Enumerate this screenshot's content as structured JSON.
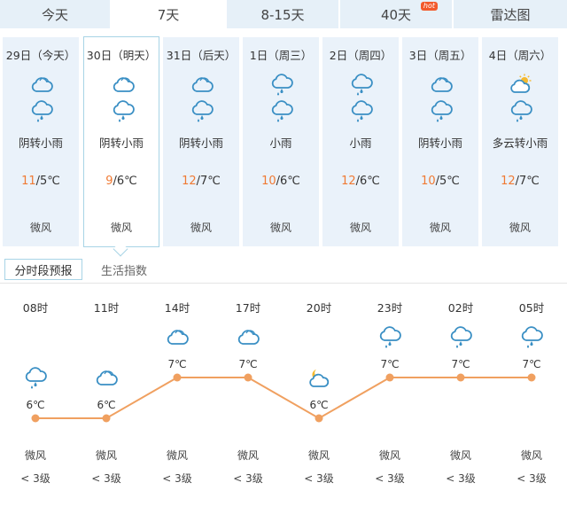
{
  "tabs": [
    {
      "label": "今天"
    },
    {
      "label": "7天"
    },
    {
      "label": "8-15天"
    },
    {
      "label": "40天",
      "badge": "hot"
    },
    {
      "label": "雷达图"
    }
  ],
  "days": [
    {
      "date": "29日（今天）",
      "icons": [
        "cloud-icon",
        "rain-icon"
      ],
      "desc": "阴转小雨",
      "high": "11",
      "low": "/5℃",
      "wind": "微风"
    },
    {
      "date": "30日（明天）",
      "icons": [
        "cloud-icon",
        "rain-icon"
      ],
      "desc": "阴转小雨",
      "high": "9",
      "low": "/6℃",
      "wind": "微风"
    },
    {
      "date": "31日（后天）",
      "icons": [
        "cloud-icon",
        "rain-icon"
      ],
      "desc": "阴转小雨",
      "high": "12",
      "low": "/7℃",
      "wind": "微风"
    },
    {
      "date": "1日（周三）",
      "icons": [
        "rain-icon",
        "rain-icon"
      ],
      "desc": "小雨",
      "high": "10",
      "low": "/6℃",
      "wind": "微风"
    },
    {
      "date": "2日（周四）",
      "icons": [
        "rain-icon",
        "rain-icon"
      ],
      "desc": "小雨",
      "high": "12",
      "low": "/6℃",
      "wind": "微风"
    },
    {
      "date": "3日（周五）",
      "icons": [
        "cloud-icon",
        "rain-icon"
      ],
      "desc": "阴转小雨",
      "high": "10",
      "low": "/5℃",
      "wind": "微风"
    },
    {
      "date": "4日（周六）",
      "icons": [
        "partly-sunny-icon",
        "rain-icon"
      ],
      "desc": "多云转小雨",
      "high": "12",
      "low": "/7℃",
      "wind": "微风"
    }
  ],
  "subtabs": {
    "forecast": "分时段预报",
    "indices": "生活指数"
  },
  "hourly": [
    {
      "time": "08时",
      "icon": "rain-icon",
      "temp": "6℃",
      "value": 6,
      "wind": "微风",
      "level": "< 3级"
    },
    {
      "time": "11时",
      "icon": "cloud-icon",
      "temp": "6℃",
      "value": 6,
      "wind": "微风",
      "level": "< 3级"
    },
    {
      "time": "14时",
      "icon": "cloud-icon",
      "temp": "7℃",
      "value": 7,
      "wind": "微风",
      "level": "< 3级"
    },
    {
      "time": "17时",
      "icon": "cloud-icon",
      "temp": "7℃",
      "value": 7,
      "wind": "微风",
      "level": "< 3级"
    },
    {
      "time": "20时",
      "icon": "cloudy-night-icon",
      "temp": "6℃",
      "value": 6,
      "wind": "微风",
      "level": "< 3级"
    },
    {
      "time": "23时",
      "icon": "rain-icon",
      "temp": "7℃",
      "value": 7,
      "wind": "微风",
      "level": "< 3级"
    },
    {
      "time": "02时",
      "icon": "rain-icon",
      "temp": "7℃",
      "value": 7,
      "wind": "微风",
      "level": "< 3级"
    },
    {
      "time": "05时",
      "icon": "rain-icon",
      "temp": "7℃",
      "value": 7,
      "wind": "微风",
      "level": "< 3级"
    }
  ],
  "colors": {
    "accent": "#f07a33",
    "panel": "#eaf2fa",
    "icon": "#3a8fc4",
    "trend": "#f0a060"
  }
}
